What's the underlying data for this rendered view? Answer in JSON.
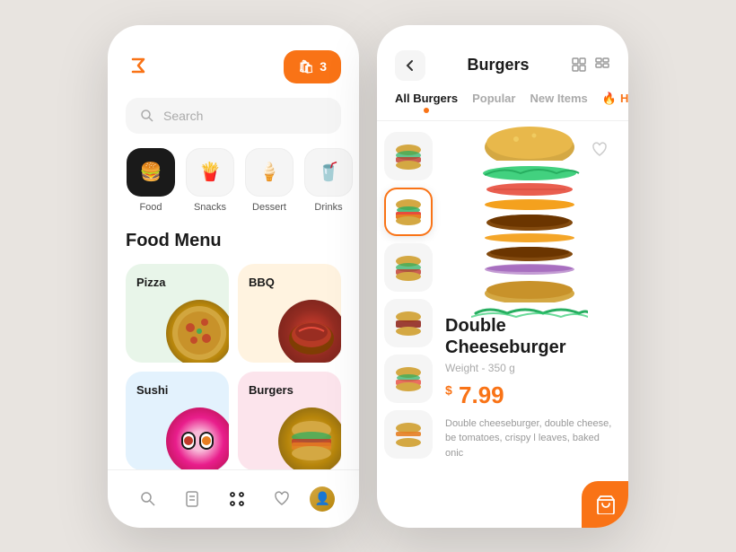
{
  "app": {
    "logo_symbol": "₴",
    "background_color": "#e8e4e0"
  },
  "left_phone": {
    "cart": {
      "count": "3",
      "icon": "🛍",
      "label": "3"
    },
    "search": {
      "placeholder": "Search"
    },
    "categories": [
      {
        "id": "food",
        "label": "Food",
        "icon": "🍔",
        "active": true
      },
      {
        "id": "snacks",
        "label": "Snacks",
        "icon": "🍟",
        "active": false
      },
      {
        "id": "dessert",
        "label": "Dessert",
        "icon": "🍦",
        "active": false
      },
      {
        "id": "drinks",
        "label": "Drinks",
        "icon": "🥤",
        "active": false
      }
    ],
    "menu_title": "Food Menu",
    "food_items": [
      {
        "id": "pizza",
        "label": "Pizza",
        "emoji": "🍕",
        "bg": "pizza"
      },
      {
        "id": "bbq",
        "label": "BBQ",
        "emoji": "🥩",
        "bg": "bbq"
      },
      {
        "id": "sushi",
        "label": "Sushi",
        "emoji": "🍣",
        "bg": "sushi"
      },
      {
        "id": "burgers",
        "label": "Burgers",
        "emoji": "🍔",
        "bg": "burgers"
      }
    ],
    "bottom_nav": [
      {
        "id": "search",
        "icon": "search",
        "active": false
      },
      {
        "id": "orders",
        "icon": "receipt",
        "active": false
      },
      {
        "id": "menu",
        "icon": "grid",
        "active": true
      },
      {
        "id": "wishlist",
        "icon": "heart",
        "active": false
      },
      {
        "id": "profile",
        "icon": "avatar",
        "active": false
      }
    ]
  },
  "right_phone": {
    "header": {
      "back_label": "‹",
      "title": "Burgers",
      "grid_icon": "⊞",
      "list_icon": "⊟"
    },
    "tabs": [
      {
        "id": "all",
        "label": "All Burgers",
        "active": true
      },
      {
        "id": "popular",
        "label": "Popular",
        "active": false
      },
      {
        "id": "new",
        "label": "New Items",
        "active": false
      },
      {
        "id": "hot",
        "label": "Hot De",
        "active": false,
        "fire": true
      }
    ],
    "thumbnails": [
      {
        "id": "t1",
        "emoji": "🍔",
        "selected": false
      },
      {
        "id": "t2",
        "emoji": "🍔",
        "selected": true
      },
      {
        "id": "t3",
        "emoji": "🍔",
        "selected": false
      },
      {
        "id": "t4",
        "emoji": "🍔",
        "selected": false
      },
      {
        "id": "t5",
        "emoji": "🍔",
        "selected": false
      },
      {
        "id": "t6",
        "emoji": "🍔",
        "selected": false
      }
    ],
    "product": {
      "name": "Double Cheeseburger",
      "weight": "Weight - 350 g",
      "price_symbol": "$",
      "price": "7.99",
      "description": "Double cheeseburger, double cheese, be tomatoes, crispy l leaves, baked onic",
      "wishlist_icon": "♡",
      "add_cart_icon": "🛒"
    }
  }
}
